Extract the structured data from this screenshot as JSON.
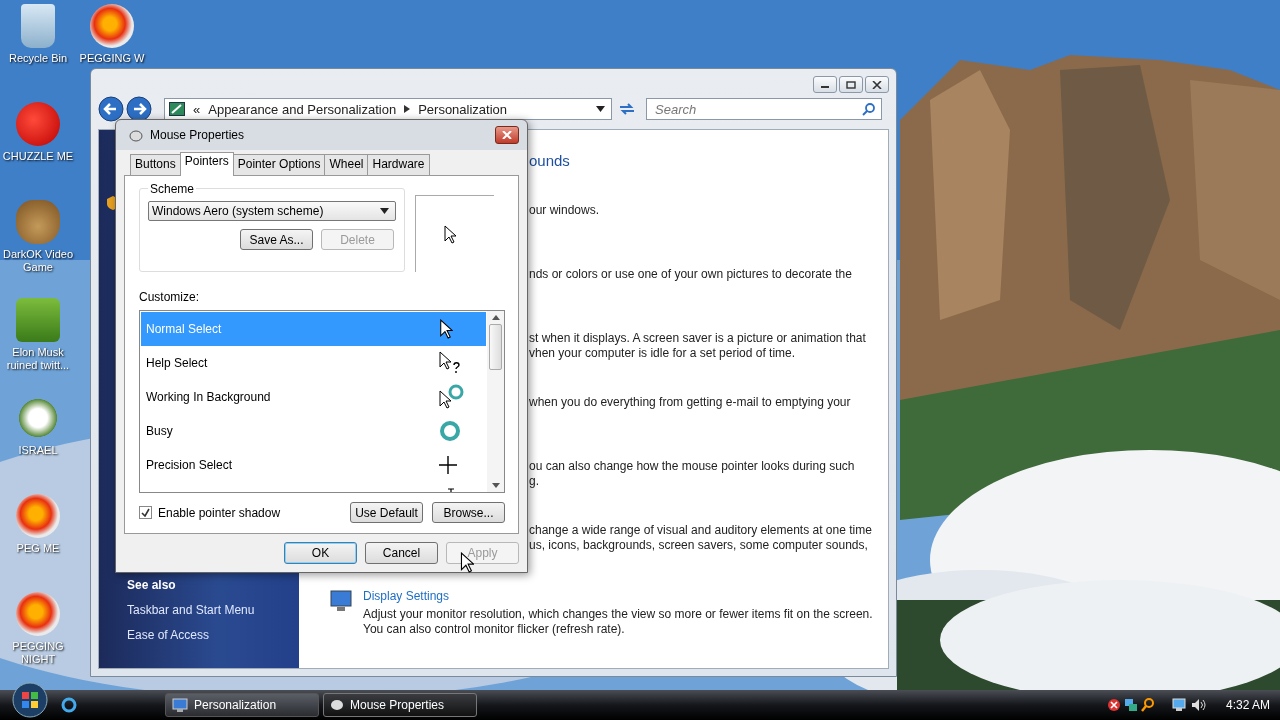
{
  "desktop_icons": [
    {
      "label": "Recycle Bin",
      "kind": "bin"
    },
    {
      "label": "CHUZZLE ME",
      "kind": "fuzz"
    },
    {
      "label": "DarkOK Video Game",
      "kind": "money"
    },
    {
      "label": "Elon Musk ruined twitt...",
      "kind": "box"
    },
    {
      "label": "ISRAEL",
      "kind": "flower"
    },
    {
      "label": "PEG ME",
      "kind": "peg"
    },
    {
      "label": "PEGGING NIGHT",
      "kind": "peg"
    }
  ],
  "desktop_icons_2": [
    {
      "label": "PEGGING W",
      "kind": "peg"
    }
  ],
  "explorer": {
    "breadcrumb_prefix": "«",
    "breadcrumb": [
      "Appearance and Personalization",
      "Personalization"
    ],
    "search": {
      "placeholder": "Search"
    },
    "heading": "ounds",
    "sections": [
      {
        "lines": [
          "our windows."
        ]
      },
      {
        "lines": [
          "nds or colors or use one of your own pictures to decorate the"
        ]
      },
      {
        "lines": [
          "st when it displays. A screen saver is a picture or animation that",
          "vhen your computer is idle for a set period of time."
        ]
      },
      {
        "lines": [
          "when you do everything from getting e-mail to emptying your"
        ]
      },
      {
        "lines": [
          "ou can also change how the mouse pointer looks during such",
          "g."
        ]
      },
      {
        "lines": [
          "change a wide range of visual and auditory elements at one time",
          "us, icons, backgrounds, screen savers, some computer sounds,"
        ]
      }
    ],
    "display_settings": {
      "title": "Display Settings",
      "lines": [
        "Adjust your monitor resolution, which changes the view so more or fewer items fit on the screen.",
        "You can also control monitor flicker (refresh rate)."
      ]
    },
    "see_also": {
      "title": "See also",
      "links": [
        "Taskbar and Start Menu",
        "Ease of Access"
      ]
    }
  },
  "dialog": {
    "title": "Mouse Properties",
    "tabs": [
      {
        "label": "Buttons",
        "selected": false
      },
      {
        "label": "Pointers",
        "selected": true
      },
      {
        "label": "Pointer Options",
        "selected": false
      },
      {
        "label": "Wheel",
        "selected": false
      },
      {
        "label": "Hardware",
        "selected": false
      }
    ],
    "scheme": {
      "label": "Scheme",
      "value": "Windows Aero (system scheme)",
      "buttons": [
        {
          "label": "Save As...",
          "disabled": false
        },
        {
          "label": "Delete",
          "disabled": true
        }
      ]
    },
    "customize": {
      "label": "Customize:",
      "items": [
        {
          "label": "Normal Select",
          "kind": "arrow",
          "selected": true
        },
        {
          "label": "Help Select",
          "kind": "help",
          "selected": false
        },
        {
          "label": "Working In Background",
          "kind": "working",
          "selected": false
        },
        {
          "label": "Busy",
          "kind": "busy",
          "selected": false
        },
        {
          "label": "Precision Select",
          "kind": "cross",
          "selected": false
        },
        {
          "kind": "text",
          "selected": false
        }
      ]
    },
    "shadow": {
      "label": "Enable pointer shadow",
      "checked": true
    },
    "list_buttons": [
      "Use Default",
      "Browse..."
    ],
    "buttons": [
      {
        "label": "OK",
        "disabled": false
      },
      {
        "label": "Cancel",
        "disabled": false
      },
      {
        "label": "Apply",
        "disabled": true
      }
    ]
  },
  "taskbar": {
    "tasks": [
      {
        "label": "Personalization",
        "selected": false,
        "kind": "monitor"
      },
      {
        "label": "Mouse Properties",
        "selected": true,
        "kind": "mouse"
      }
    ],
    "time": "4:32 AM"
  }
}
